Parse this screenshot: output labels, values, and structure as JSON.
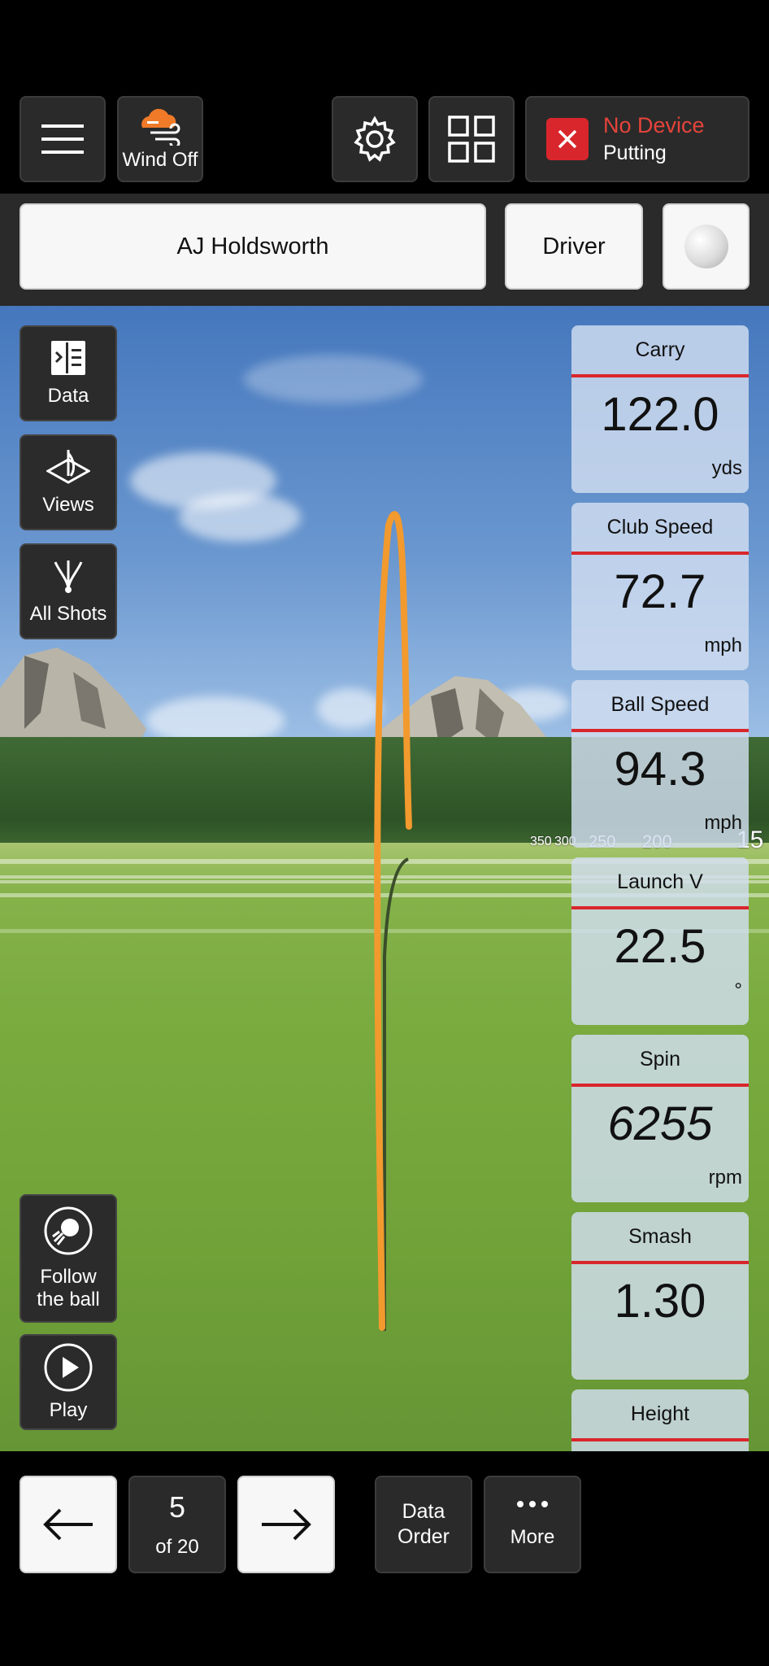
{
  "top_bar": {
    "wind_label": "Wind Off",
    "device_status": "No Device",
    "device_mode": "Putting",
    "colors": {
      "wind_icon": "#f07a28",
      "device_error": "#d9262c"
    }
  },
  "player_bar": {
    "player_name": "AJ Holdsworth",
    "club": "Driver"
  },
  "side_menu": {
    "data_label": "Data",
    "views_label": "Views",
    "all_shots_label": "All Shots",
    "follow_label_line1": "Follow",
    "follow_label_line2": "the ball",
    "play_label": "Play"
  },
  "distance_markers": [
    "350",
    "300",
    "250",
    "200",
    "15"
  ],
  "metrics": [
    {
      "label": "Carry",
      "value": "122.0",
      "unit": "yds"
    },
    {
      "label": "Club Speed",
      "value": "72.7",
      "unit": "mph"
    },
    {
      "label": "Ball Speed",
      "value": "94.3",
      "unit": "mph"
    },
    {
      "label": "Launch V",
      "value": "22.5",
      "unit": "°"
    },
    {
      "label": "Spin",
      "value": "6255",
      "unit": "rpm"
    },
    {
      "label": "Smash",
      "value": "1.30",
      "unit": ""
    },
    {
      "label": "Height",
      "value": "",
      "unit": ""
    }
  ],
  "bottom_bar": {
    "shot_number": "5",
    "shot_total": "of 20",
    "data_order_line1": "Data",
    "data_order_line2": "Order",
    "more_label": "More"
  }
}
